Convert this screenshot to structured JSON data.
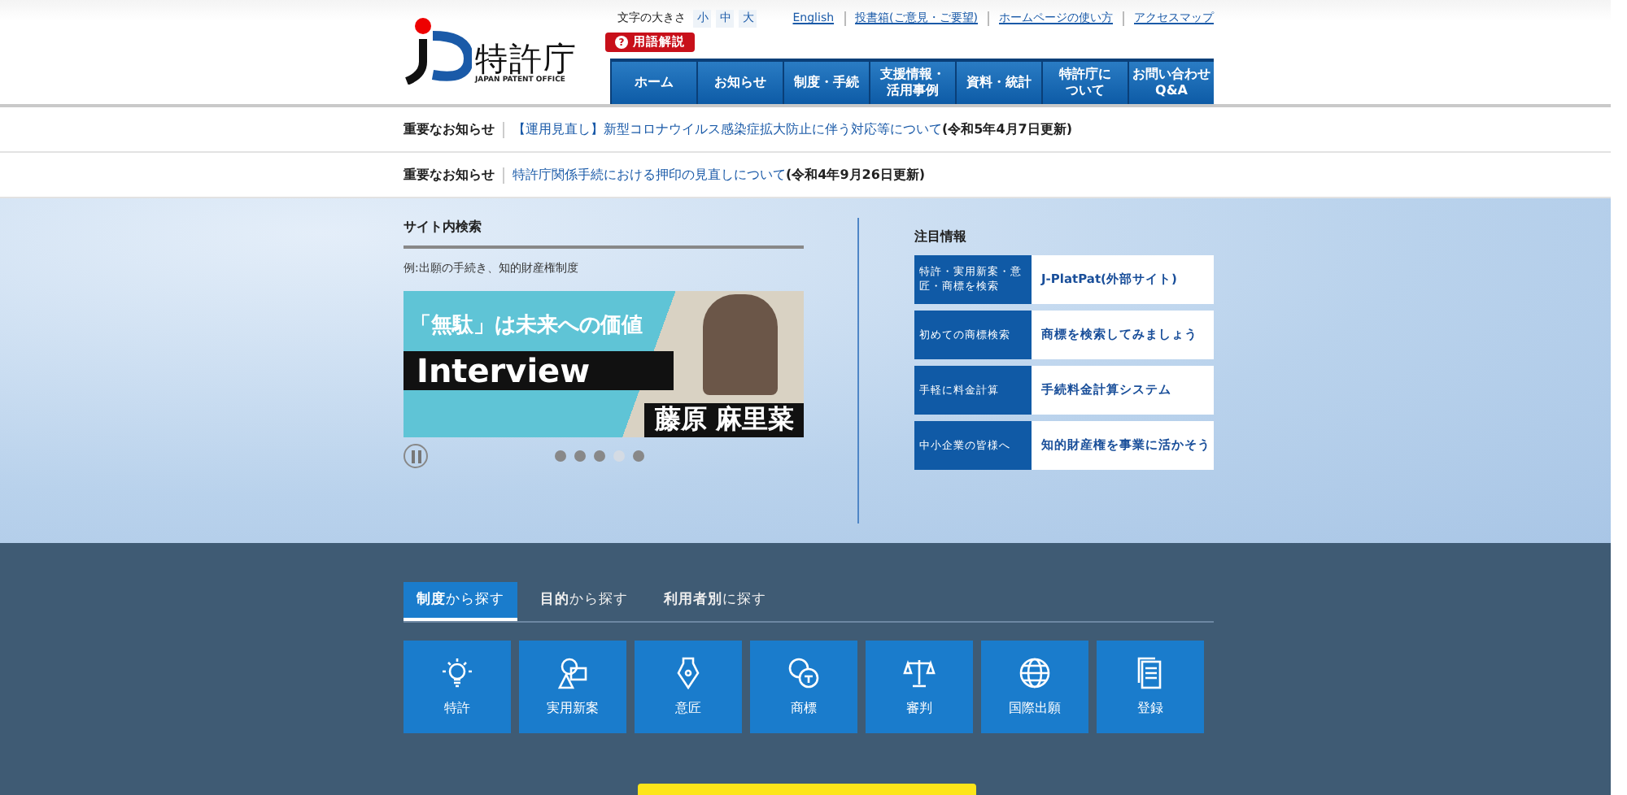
{
  "header": {
    "logo_text": "特許庁",
    "logo_subtext": "JAPAN PATENT OFFICE",
    "font_size_label": "文字の大きさ",
    "font_sizes": [
      {
        "label": "小",
        "selected": false
      },
      {
        "label": "中",
        "selected": false
      },
      {
        "label": "大",
        "selected": false
      }
    ],
    "utility_links": [
      "English",
      "投書箱(ご意見・ご要望)",
      "ホームページの使い方",
      "アクセスマップ"
    ],
    "glossary_icon": "?",
    "glossary_button": "用語解説",
    "nav": [
      [
        "ホーム"
      ],
      [
        "お知らせ"
      ],
      [
        "制度・手続"
      ],
      [
        "支援情報・",
        "活用事例"
      ],
      [
        "資料・統計"
      ],
      [
        "特許庁に",
        "ついて"
      ],
      [
        "お問い合わせ",
        "Q&A"
      ]
    ]
  },
  "notices": [
    {
      "label": "重要なお知らせ",
      "link": "【運用見直し】新型コロナウイルス感染症拡大防止に伴う対応等について",
      "date": "(令和5年4月7日更新)"
    },
    {
      "label": "重要なお知らせ",
      "link": "特許庁関係手続における押印の見直しについて",
      "date": "(令和4年9月26日更新)"
    }
  ],
  "search": {
    "title": "サイト内検索",
    "placeholder": "例:出願の手続き、知的財産権制度"
  },
  "banner": {
    "headline": "「無駄」は未来への価値",
    "tag": "Interview",
    "name": "藤原 麻里菜"
  },
  "slider_dots": [
    {
      "selected": false
    },
    {
      "selected": false
    },
    {
      "selected": false
    },
    {
      "selected": true
    },
    {
      "selected": false
    }
  ],
  "featured": {
    "title": "注目情報",
    "items": [
      {
        "label": "特許・実用新案・意匠・商標を検索",
        "link": "J-PlatPat(外部サイト)"
      },
      {
        "label": "初めての商標検索",
        "link": "商標を検索してみましょう"
      },
      {
        "label": "手軽に料金計算",
        "link": "手続料金計算システム"
      },
      {
        "label": "中小企業の皆様へ",
        "link": "知的財産権を事業に活かそう"
      }
    ]
  },
  "browse_tabs": [
    {
      "label": "**制度**から探す",
      "selected": true
    },
    {
      "label": "**目的**から探す",
      "selected": false
    },
    {
      "label": "**利用者別**に探す",
      "selected": false
    }
  ],
  "categories": [
    "特許",
    "実用新案",
    "意匠",
    "商標",
    "審判",
    "国際出願",
    "登録"
  ]
}
